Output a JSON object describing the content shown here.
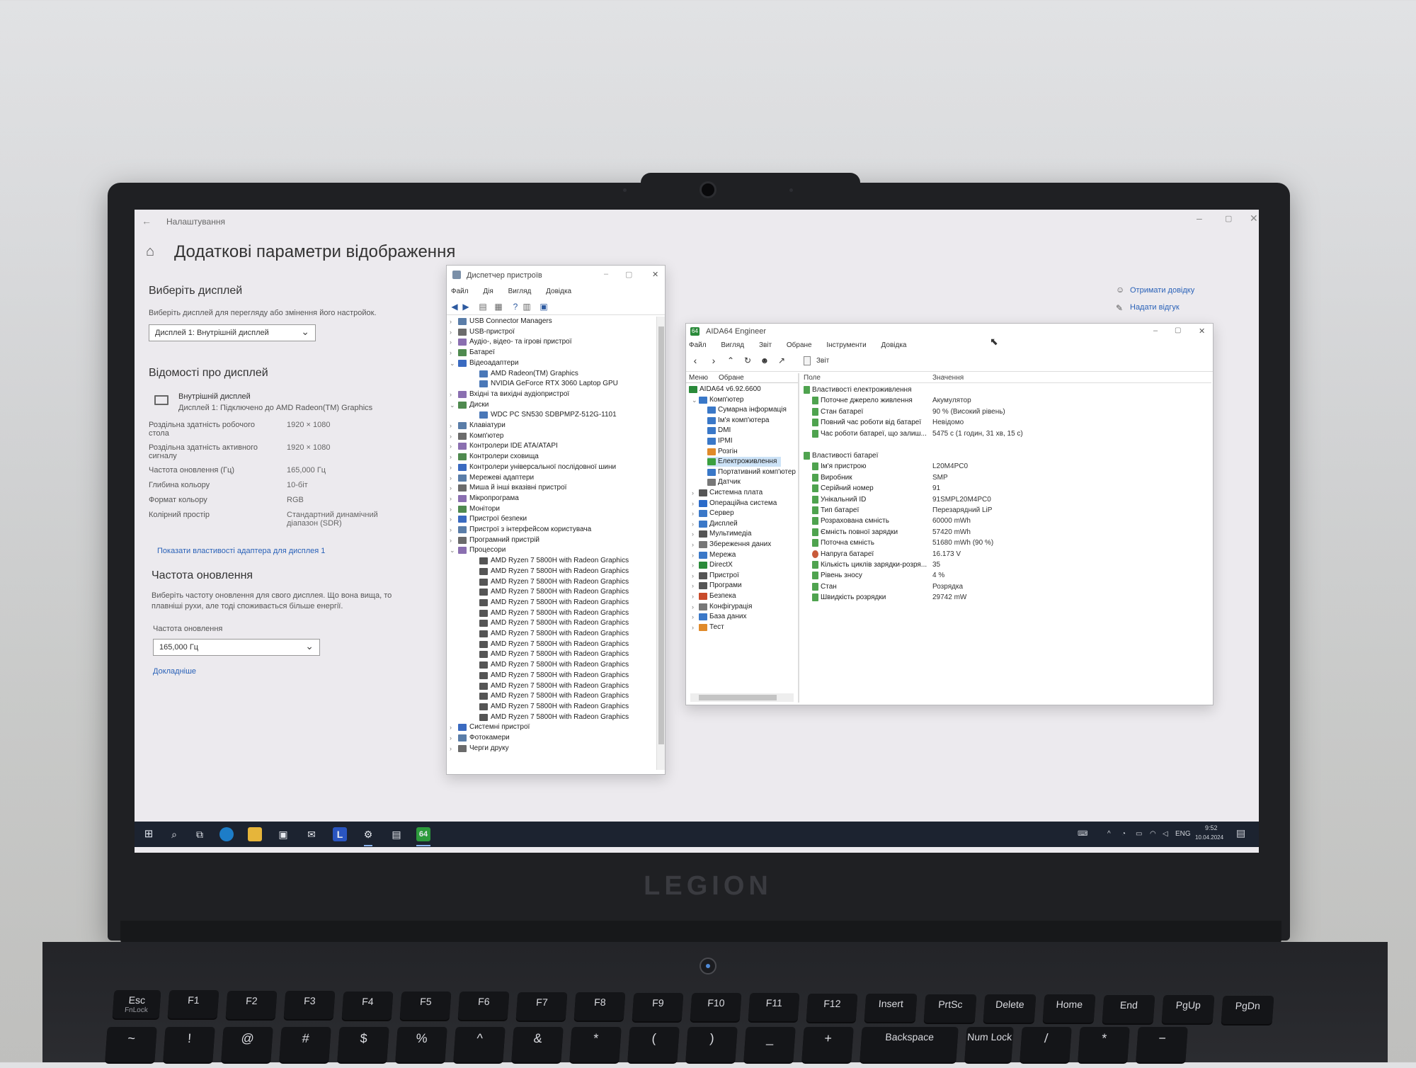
{
  "settings": {
    "title": "Налаштування",
    "heading": "Додаткові параметри відображення",
    "select_display": {
      "heading": "Виберіть дисплей",
      "description": "Виберіть дисплей для перегляду або змінення його настройок.",
      "dropdown_value": "Дисплей 1: Внутрішній дисплей"
    },
    "display_info": {
      "heading": "Відомості про дисплей",
      "display_name": "Внутрішній дисплей",
      "display_sub": "Дисплей 1: Підключено до AMD Radeon(TM) Graphics",
      "rows": [
        {
          "label": "Роздільна здатність робочого стола",
          "value": "1920 × 1080"
        },
        {
          "label": "Роздільна здатність активного сигналу",
          "value": "1920 × 1080"
        },
        {
          "label": "Частота оновлення (Гц)",
          "value": "165,000 Гц"
        },
        {
          "label": "Глибина кольору",
          "value": "10-біт"
        },
        {
          "label": "Формат кольору",
          "value": "RGB"
        },
        {
          "label": "Колірний простір",
          "value": "Стандартний динамічний діапазон (SDR)"
        }
      ],
      "adapter_link": "Показати властивості адаптера для дисплея 1"
    },
    "refresh": {
      "heading": "Частота оновлення",
      "description": "Виберіть частоту оновлення для свого дисплея. Що вона вища, то плавніші рухи, але тоді споживається більше енергії.",
      "label": "Частота оновлення",
      "dropdown_value": "165,000 Гц",
      "more_link": "Докладніше"
    },
    "side_links": [
      "Отримати довідку",
      "Надати відгук"
    ]
  },
  "device_manager": {
    "title": "Диспетчер пристроїв",
    "menu": [
      "Файл",
      "Дія",
      "Вигляд",
      "Довідка"
    ],
    "items": [
      {
        "label": "USB Connector Managers",
        "level": 0,
        "arrow": "›"
      },
      {
        "label": "USB-пристрої",
        "level": 0,
        "arrow": "›"
      },
      {
        "label": "Аудіо-, відео- та ігрові пристрої",
        "level": 0,
        "arrow": "›"
      },
      {
        "label": "Батареї",
        "level": 0,
        "arrow": "›"
      },
      {
        "label": "Відеоадаптери",
        "level": 0,
        "arrow": "⌄"
      },
      {
        "label": "AMD Radeon(TM) Graphics",
        "level": 1,
        "arrow": ""
      },
      {
        "label": "NVIDIA GeForce RTX 3060 Laptop GPU",
        "level": 1,
        "arrow": ""
      },
      {
        "label": "Вхідні та вихідні аудіопристрої",
        "level": 0,
        "arrow": "›"
      },
      {
        "label": "Диски",
        "level": 0,
        "arrow": "⌄"
      },
      {
        "label": "WDC PC SN530 SDBPMPZ-512G-1101",
        "level": 1,
        "arrow": ""
      },
      {
        "label": "Клавіатури",
        "level": 0,
        "arrow": "›"
      },
      {
        "label": "Комп'ютер",
        "level": 0,
        "arrow": "›"
      },
      {
        "label": "Контролери IDE ATA/ATAPI",
        "level": 0,
        "arrow": "›"
      },
      {
        "label": "Контролери сховища",
        "level": 0,
        "arrow": "›"
      },
      {
        "label": "Контролери універсальної послідовної шини",
        "level": 0,
        "arrow": "›"
      },
      {
        "label": "Мережеві адаптери",
        "level": 0,
        "arrow": "›"
      },
      {
        "label": "Миша й інші вказівні пристрої",
        "level": 0,
        "arrow": "›"
      },
      {
        "label": "Мікропрограма",
        "level": 0,
        "arrow": "›"
      },
      {
        "label": "Монітори",
        "level": 0,
        "arrow": "›"
      },
      {
        "label": "Пристрої безпеки",
        "level": 0,
        "arrow": "›"
      },
      {
        "label": "Пристрої з інтерфейсом користувача",
        "level": 0,
        "arrow": "›"
      },
      {
        "label": "Програмний пристрій",
        "level": 0,
        "arrow": "›"
      },
      {
        "label": "Процесори",
        "level": 0,
        "arrow": "⌄"
      },
      {
        "label": "AMD Ryzen 7 5800H with Radeon Graphics",
        "level": 1,
        "arrow": ""
      },
      {
        "label": "AMD Ryzen 7 5800H with Radeon Graphics",
        "level": 1,
        "arrow": ""
      },
      {
        "label": "AMD Ryzen 7 5800H with Radeon Graphics",
        "level": 1,
        "arrow": ""
      },
      {
        "label": "AMD Ryzen 7 5800H with Radeon Graphics",
        "level": 1,
        "arrow": ""
      },
      {
        "label": "AMD Ryzen 7 5800H with Radeon Graphics",
        "level": 1,
        "arrow": ""
      },
      {
        "label": "AMD Ryzen 7 5800H with Radeon Graphics",
        "level": 1,
        "arrow": ""
      },
      {
        "label": "AMD Ryzen 7 5800H with Radeon Graphics",
        "level": 1,
        "arrow": ""
      },
      {
        "label": "AMD Ryzen 7 5800H with Radeon Graphics",
        "level": 1,
        "arrow": ""
      },
      {
        "label": "AMD Ryzen 7 5800H with Radeon Graphics",
        "level": 1,
        "arrow": ""
      },
      {
        "label": "AMD Ryzen 7 5800H with Radeon Graphics",
        "level": 1,
        "arrow": ""
      },
      {
        "label": "AMD Ryzen 7 5800H with Radeon Graphics",
        "level": 1,
        "arrow": ""
      },
      {
        "label": "AMD Ryzen 7 5800H with Radeon Graphics",
        "level": 1,
        "arrow": ""
      },
      {
        "label": "AMD Ryzen 7 5800H with Radeon Graphics",
        "level": 1,
        "arrow": ""
      },
      {
        "label": "AMD Ryzen 7 5800H with Radeon Graphics",
        "level": 1,
        "arrow": ""
      },
      {
        "label": "AMD Ryzen 7 5800H with Radeon Graphics",
        "level": 1,
        "arrow": ""
      },
      {
        "label": "AMD Ryzen 7 5800H with Radeon Graphics",
        "level": 1,
        "arrow": ""
      },
      {
        "label": "Системні пристрої",
        "level": 0,
        "arrow": "›"
      },
      {
        "label": "Фотокамери",
        "level": 0,
        "arrow": "›"
      },
      {
        "label": "Черги друку",
        "level": 0,
        "arrow": "›"
      }
    ]
  },
  "aida": {
    "title": "AIDA64 Engineer",
    "menu": [
      "Файл",
      "Вигляд",
      "Звіт",
      "Обране",
      "Інструменти",
      "Довідка"
    ],
    "report_label": "Звіт",
    "tabs": [
      "Меню",
      "Обране"
    ],
    "col_field": "Поле",
    "col_value": "Значення",
    "tree": [
      {
        "label": "AIDA64 v6.92.6600",
        "level": 0,
        "icon": "#2a8a3a",
        "arrow": ""
      },
      {
        "label": "Комп'ютер",
        "level": 1,
        "icon": "#3a78c8",
        "arrow": "⌄"
      },
      {
        "label": "Сумарна інформація",
        "level": 2,
        "icon": "#3a78c8",
        "arrow": ""
      },
      {
        "label": "Ім'я комп'ютера",
        "level": 2,
        "icon": "#3a78c8",
        "arrow": ""
      },
      {
        "label": "DMI",
        "level": 2,
        "icon": "#3a78c8",
        "arrow": ""
      },
      {
        "label": "IPMI",
        "level": 2,
        "icon": "#3a78c8",
        "arrow": ""
      },
      {
        "label": "Розгін",
        "level": 2,
        "icon": "#e08a2a",
        "arrow": ""
      },
      {
        "label": "Електроживлення",
        "level": 2,
        "icon": "#3aa040",
        "arrow": "",
        "selected": true
      },
      {
        "label": "Портативний комп'ютер",
        "level": 2,
        "icon": "#3a78c8",
        "arrow": ""
      },
      {
        "label": "Датчик",
        "level": 2,
        "icon": "#777777",
        "arrow": ""
      },
      {
        "label": "Системна плата",
        "level": 1,
        "icon": "#555555",
        "arrow": "›"
      },
      {
        "label": "Операційна система",
        "level": 1,
        "icon": "#2a6ac8",
        "arrow": "›"
      },
      {
        "label": "Сервер",
        "level": 1,
        "icon": "#3a78c8",
        "arrow": "›"
      },
      {
        "label": "Дисплей",
        "level": 1,
        "icon": "#3a78c8",
        "arrow": "›"
      },
      {
        "label": "Мультимедіа",
        "level": 1,
        "icon": "#555555",
        "arrow": "›"
      },
      {
        "label": "Збереження даних",
        "level": 1,
        "icon": "#777777",
        "arrow": "›"
      },
      {
        "label": "Мережа",
        "level": 1,
        "icon": "#3a78c8",
        "arrow": "›"
      },
      {
        "label": "DirectX",
        "level": 1,
        "icon": "#2a8a3a",
        "arrow": "›"
      },
      {
        "label": "Пристрої",
        "level": 1,
        "icon": "#555555",
        "arrow": "›"
      },
      {
        "label": "Програми",
        "level": 1,
        "icon": "#555555",
        "arrow": "›"
      },
      {
        "label": "Безпека",
        "level": 1,
        "icon": "#c84a2a",
        "arrow": "›"
      },
      {
        "label": "Конфігурація",
        "level": 1,
        "icon": "#777777",
        "arrow": "›"
      },
      {
        "label": "База даних",
        "level": 1,
        "icon": "#3a78c8",
        "arrow": "›"
      },
      {
        "label": "Тест",
        "level": 1,
        "icon": "#e08a2a",
        "arrow": "›"
      }
    ],
    "sections": [
      {
        "header": "Властивості електроживлення",
        "rows": [
          {
            "field": "Поточне джерело живлення",
            "value": "Акумулятор"
          },
          {
            "field": "Стан батареї",
            "value": "90 % (Високий рівень)"
          },
          {
            "field": "Повний час роботи від батареї",
            "value": "Невідомо"
          },
          {
            "field": "Час роботи батареї, що залиш...",
            "value": "5475 с (1 годин, 31 хв, 15 с)"
          }
        ]
      },
      {
        "header": "Властивості батареї",
        "rows": [
          {
            "field": "Ім'я пристрою",
            "value": "L20M4PC0"
          },
          {
            "field": "Виробник",
            "value": "SMP"
          },
          {
            "field": "Серійний номер",
            "value": "91"
          },
          {
            "field": "Унікальний ID",
            "value": "91SMPL20M4PC0"
          },
          {
            "field": "Тип батареї",
            "value": "Перезарядний LiP"
          },
          {
            "field": "Розрахована ємність",
            "value": "60000 mWh"
          },
          {
            "field": "Ємність повної зарядки",
            "value": "57420 mWh"
          },
          {
            "field": "Поточна ємність",
            "value": "51680 mWh  (90 %)"
          },
          {
            "field": "Напруга батареї",
            "value": "16.173 V"
          },
          {
            "field": "Кількість циклів зарядки-розря...",
            "value": "35"
          },
          {
            "field": "Рівень зносу",
            "value": "4 %"
          },
          {
            "field": "Стан",
            "value": "Розрядка"
          },
          {
            "field": "Швидкість розрядки",
            "value": "29742 mW"
          }
        ]
      }
    ]
  },
  "taskbar": {
    "aida_badge": "64",
    "lenovo_badge": "L",
    "lang": "ENG",
    "time": "9:52",
    "date": "10.04.2024"
  },
  "laptop": {
    "brand": "LEGION",
    "keys": [
      {
        "label": "Esc",
        "sub": "FnLock"
      },
      {
        "label": "F1",
        "sub": ""
      },
      {
        "label": "F2",
        "sub": ""
      },
      {
        "label": "F3",
        "sub": ""
      },
      {
        "label": "F4",
        "sub": ""
      },
      {
        "label": "F5",
        "sub": ""
      },
      {
        "label": "F6",
        "sub": ""
      },
      {
        "label": "F7",
        "sub": ""
      },
      {
        "label": "F8",
        "sub": ""
      },
      {
        "label": "F9",
        "sub": ""
      },
      {
        "label": "F10",
        "sub": ""
      },
      {
        "label": "F11",
        "sub": ""
      },
      {
        "label": "F12",
        "sub": ""
      },
      {
        "label": "Insert",
        "sub": ""
      },
      {
        "label": "PrtSc",
        "sub": ""
      },
      {
        "label": "Delete",
        "sub": ""
      },
      {
        "label": "Home",
        "sub": ""
      },
      {
        "label": "End",
        "sub": ""
      },
      {
        "label": "PgUp",
        "sub": ""
      },
      {
        "label": "PgDn",
        "sub": ""
      }
    ],
    "row2_keys": [
      "~",
      "!",
      "@",
      "#",
      "$",
      "%",
      "^",
      "&",
      "*",
      "(",
      ")",
      "_",
      "+",
      "Backspace",
      "Num Lock",
      "/",
      "*",
      "−"
    ]
  }
}
